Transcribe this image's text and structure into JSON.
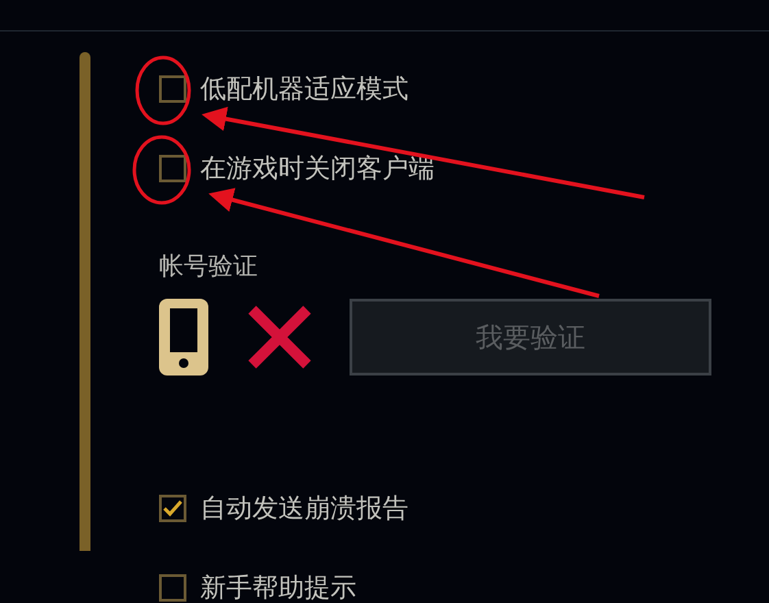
{
  "options_top": [
    {
      "label": "低配机器适应模式",
      "checked": false
    },
    {
      "label": "在游戏时关闭客户端",
      "checked": false
    }
  ],
  "account_verification": {
    "title": "帐号验证",
    "phone_verified": false,
    "button": {
      "label": "我要验证",
      "disabled": true
    }
  },
  "options_bottom": [
    {
      "label": "自动发送崩溃报告",
      "checked": true
    },
    {
      "label": "新手帮助提示",
      "checked": false
    }
  ]
}
